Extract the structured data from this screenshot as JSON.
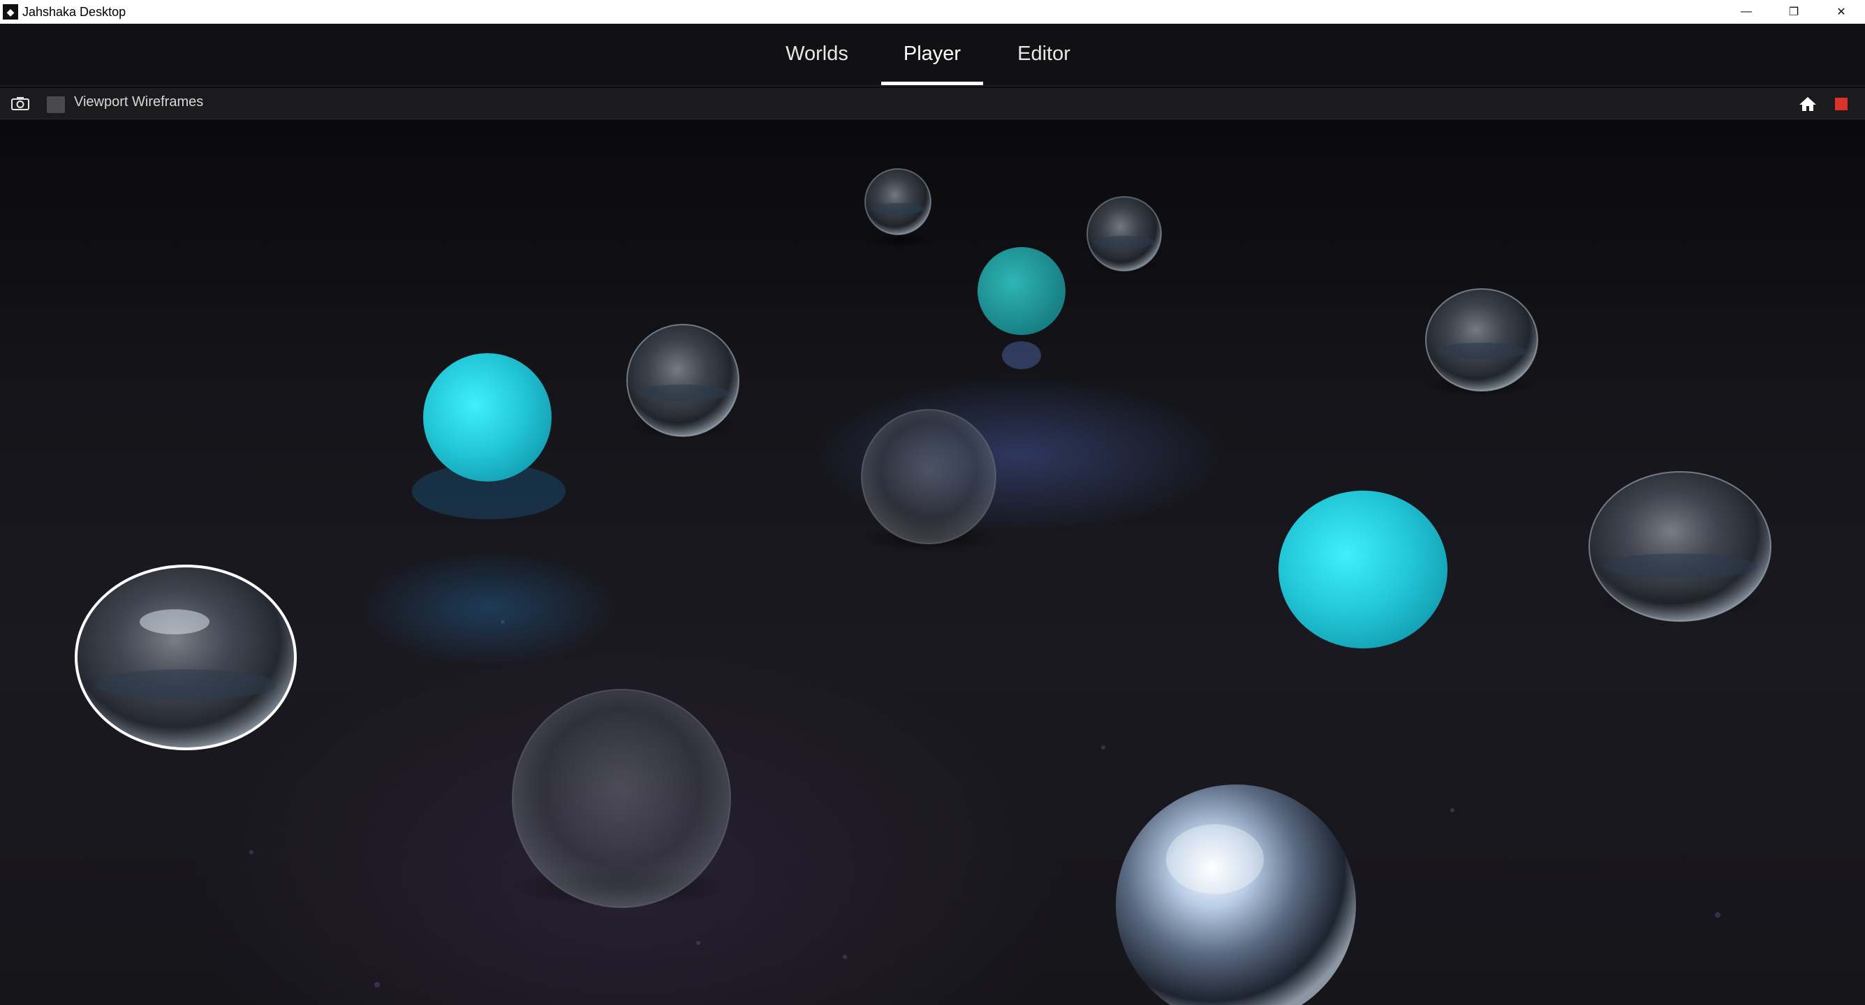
{
  "window": {
    "title": "Jahshaka Desktop",
    "controls": {
      "minimize": "—",
      "restore": "❐",
      "close": "✕"
    }
  },
  "tabs": [
    {
      "label": "Worlds",
      "active": false
    },
    {
      "label": "Player",
      "active": true
    },
    {
      "label": "Editor",
      "active": false
    }
  ],
  "toolbar": {
    "screenshot_icon": "camera-icon",
    "wireframes_checkbox_checked": false,
    "wireframes_label": "Viewport Wireframes",
    "home_icon": "home-icon",
    "stop_icon": "stop-icon",
    "stop_color": "#d8322b"
  },
  "scene": {
    "floor": "dark asphalt",
    "objects": [
      {
        "kind": "glass-sphere"
      },
      {
        "kind": "glass-sphere"
      },
      {
        "kind": "teal-sphere",
        "color": "#1f9a9c"
      },
      {
        "kind": "glass-sphere"
      },
      {
        "kind": "teal-sphere",
        "color": "#2ad4e0"
      },
      {
        "kind": "glass-sphere"
      },
      {
        "kind": "glass-sphere"
      },
      {
        "kind": "teal-sphere",
        "color": "#26d0e0"
      },
      {
        "kind": "glass-sphere"
      },
      {
        "kind": "glass-sphere"
      },
      {
        "kind": "glass-sphere"
      },
      {
        "kind": "chrome-sphere"
      }
    ]
  },
  "colors": {
    "accent_underline": "#ffffff",
    "teal": "#26d0e0",
    "stop": "#d8322b"
  }
}
